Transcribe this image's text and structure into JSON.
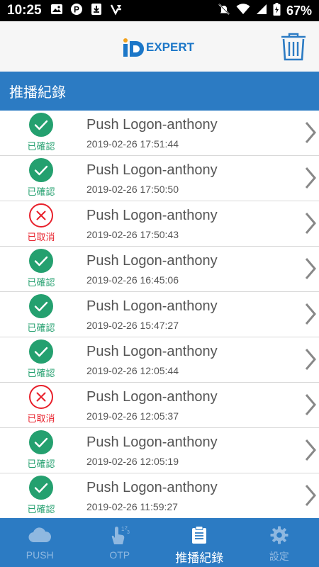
{
  "status_bar": {
    "time": "10:25",
    "battery": "67%"
  },
  "header": {
    "logo_text": "EXPERT"
  },
  "section": {
    "title": "推播紀錄"
  },
  "colors": {
    "primary": "#2c7bc3",
    "confirmed": "#24a06f",
    "cancelled": "#e8202b",
    "logo": "#1c77c8"
  },
  "records": [
    {
      "status": "confirmed",
      "status_label": "已確認",
      "title": "Push Logon-anthony",
      "time": "2019-02-26 17:51:44"
    },
    {
      "status": "confirmed",
      "status_label": "已確認",
      "title": "Push Logon-anthony",
      "time": "2019-02-26 17:50:50"
    },
    {
      "status": "cancelled",
      "status_label": "已取消",
      "title": "Push Logon-anthony",
      "time": "2019-02-26 17:50:43"
    },
    {
      "status": "confirmed",
      "status_label": "已確認",
      "title": "Push Logon-anthony",
      "time": "2019-02-26 16:45:06"
    },
    {
      "status": "confirmed",
      "status_label": "已確認",
      "title": "Push Logon-anthony",
      "time": "2019-02-26 15:47:27"
    },
    {
      "status": "confirmed",
      "status_label": "已確認",
      "title": "Push Logon-anthony",
      "time": "2019-02-26 12:05:44"
    },
    {
      "status": "cancelled",
      "status_label": "已取消",
      "title": "Push Logon-anthony",
      "time": "2019-02-26 12:05:37"
    },
    {
      "status": "confirmed",
      "status_label": "已確認",
      "title": "Push Logon-anthony",
      "time": "2019-02-26 12:05:19"
    },
    {
      "status": "confirmed",
      "status_label": "已確認",
      "title": "Push Logon-anthony",
      "time": "2019-02-26 11:59:27"
    }
  ],
  "bottom_nav": {
    "tabs": [
      {
        "label": "PUSH",
        "icon": "cloud-icon",
        "active": false
      },
      {
        "label": "OTP",
        "icon": "hand-otp-icon",
        "active": false
      },
      {
        "label": "推播紀錄",
        "icon": "clipboard-icon",
        "active": true
      },
      {
        "label": "設定",
        "icon": "gear-icon",
        "active": false
      }
    ]
  }
}
